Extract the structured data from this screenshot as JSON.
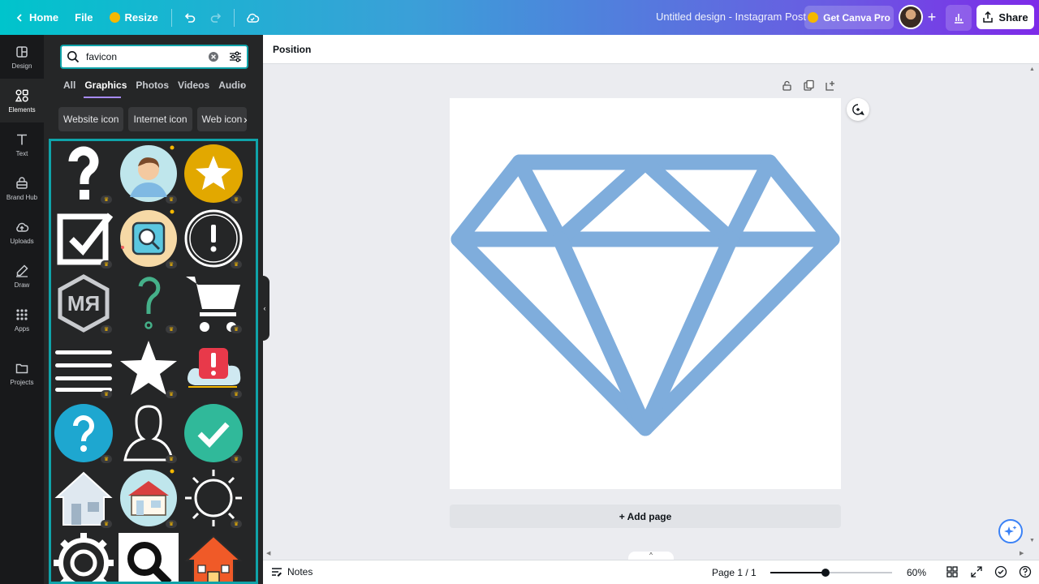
{
  "topbar": {
    "home_label": "Home",
    "file_label": "File",
    "resize_label": "Resize",
    "document_title": "Untitled design - Instagram Post",
    "get_pro_label": "Get Canva Pro",
    "share_label": "Share"
  },
  "rail": {
    "items": [
      {
        "label": "Design",
        "icon": "design-icon"
      },
      {
        "label": "Elements",
        "icon": "elements-icon",
        "active": true
      },
      {
        "label": "Text",
        "icon": "text-icon"
      },
      {
        "label": "Brand Hub",
        "icon": "brand-hub-icon"
      },
      {
        "label": "Uploads",
        "icon": "uploads-icon"
      },
      {
        "label": "Draw",
        "icon": "draw-icon"
      },
      {
        "label": "Apps",
        "icon": "apps-icon"
      },
      {
        "label": "Projects",
        "icon": "projects-icon"
      }
    ]
  },
  "panel": {
    "search_value": "favicon",
    "tabs": [
      "All",
      "Graphics",
      "Photos",
      "Videos",
      "Audio"
    ],
    "active_tab": "Graphics",
    "chips": [
      "Website icon",
      "Internet icon",
      "Web icon"
    ],
    "results": [
      "question-mark-graphic",
      "man-avatar-graphic",
      "star-badge-graphic",
      "checkbox-graphic",
      "magnifier-app-graphic",
      "exclamation-circle-graphic",
      "monogram-mr-graphic",
      "green-question-graphic",
      "shopping-cart-graphic",
      "menu-lines-graphic",
      "white-star-graphic",
      "alert-cloud-graphic",
      "blue-question-graphic",
      "person-outline-graphic",
      "green-check-graphic",
      "house-graphic",
      "shop-building-graphic",
      "sun-outline-graphic",
      "gear-graphic",
      "search-icon-graphic",
      "orange-house-graphic"
    ]
  },
  "workspace": {
    "context_label": "Position",
    "add_page_label": "+ Add page",
    "canvas_graphic": "diamond-outline",
    "diamond_color": "#7faddc"
  },
  "footer": {
    "notes_label": "Notes",
    "page_indicator": "Page 1 / 1",
    "zoom_label": "60%",
    "zoom_fraction": 0.45
  },
  "colors": {
    "accent_teal": "#0fa3a9",
    "panel_bg": "#252627",
    "rail_bg": "#18191b",
    "pro_crown": "#f5b800"
  }
}
